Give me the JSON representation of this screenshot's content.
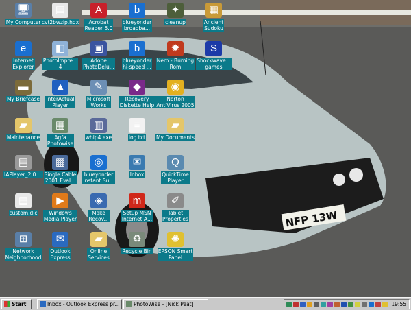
{
  "desktop": {
    "icons": [
      {
        "label": "My Computer",
        "icon": "my-computer-icon",
        "glyph": "🖥",
        "color": "#5a7fa8"
      },
      {
        "label": "cvt2bwzip.hqx",
        "icon": "file-icon",
        "glyph": "▤",
        "color": "#e8e8e8"
      },
      {
        "label": "Acrobat\nReader 5.0",
        "icon": "acrobat-icon",
        "glyph": "A",
        "color": "#c8202a"
      },
      {
        "label": "blueyonder\nbroadba...",
        "icon": "blueyonder-icon",
        "glyph": "b",
        "color": "#1a6fd0"
      },
      {
        "label": "cleanup",
        "icon": "cleanup-icon",
        "glyph": "✦",
        "color": "#4d5e3a"
      },
      {
        "label": "Ancient\nSudoku",
        "icon": "sudoku-icon",
        "glyph": "▦",
        "color": "#c99a38"
      },
      {
        "label": "Internet\nExplorer",
        "icon": "internet-explorer-icon",
        "glyph": "e",
        "color": "#1a6fd0"
      },
      {
        "label": "PhotoImpre...\n4",
        "icon": "photoimpression-icon",
        "glyph": "◧",
        "color": "#8fb2d8"
      },
      {
        "label": "Adobe\nPhotoDelu...",
        "icon": "photodeluxe-icon",
        "glyph": "▣",
        "color": "#3a54a0"
      },
      {
        "label": "blueyonder\nhi-speed ...",
        "icon": "blueyonder-icon",
        "glyph": "b",
        "color": "#1a6fd0"
      },
      {
        "label": "Nero - Burning\nRom",
        "icon": "nero-icon",
        "glyph": "✹",
        "color": "#c03a1e"
      },
      {
        "label": "Shockwave...\ngames",
        "icon": "shockwave-icon",
        "glyph": "S",
        "color": "#1c3aa8"
      },
      {
        "label": "My Briefcase",
        "icon": "briefcase-icon",
        "glyph": "▬",
        "color": "#7c6b3a"
      },
      {
        "label": "InterActual\nPlayer",
        "icon": "interactual-icon",
        "glyph": "▲",
        "color": "#2060c0"
      },
      {
        "label": "Microsoft\nWorks",
        "icon": "works-icon",
        "glyph": "✎",
        "color": "#6c8fb5"
      },
      {
        "label": "Recovery\nDiskette Help",
        "icon": "recovery-help-icon",
        "glyph": "◆",
        "color": "#7a2a8a"
      },
      {
        "label": "Norton\nAntiVirus 2005",
        "icon": "norton-icon",
        "glyph": "◉",
        "color": "#e3b020"
      },
      {
        "label": "Maintenance",
        "icon": "folder-icon",
        "glyph": "▰",
        "color": "#e4c66a"
      },
      {
        "label": "Agfa\nPhotowise",
        "icon": "agfa-icon",
        "glyph": "▦",
        "color": "#6a8a6a"
      },
      {
        "label": "whip4.exe",
        "icon": "exe-icon",
        "glyph": "▥",
        "color": "#5a6a9a"
      },
      {
        "label": "log.txt",
        "icon": "text-file-icon",
        "glyph": "≡",
        "color": "#f2f2f2"
      },
      {
        "label": "My Documents",
        "icon": "folder-icon",
        "glyph": "▰",
        "color": "#e4c66a"
      },
      {
        "label": "IAPlayer_2.0....",
        "icon": "installer-icon",
        "glyph": "▤",
        "color": "#9a9a9a"
      },
      {
        "label": "Single Cable\n2001 Eval...",
        "icon": "single-cable-icon",
        "glyph": "▩",
        "color": "#4a6a9a"
      },
      {
        "label": "blueyonder\nInstant Su...",
        "icon": "blueyonder-icon",
        "glyph": "◎",
        "color": "#1a6fd0"
      },
      {
        "label": "Inbox",
        "icon": "inbox-icon",
        "glyph": "✉",
        "color": "#3a7ab0"
      },
      {
        "label": "QuickTime\nPlayer",
        "icon": "quicktime-icon",
        "glyph": "Q",
        "color": "#5a8ab0"
      },
      {
        "label": "custom.dic",
        "icon": "dic-file-icon",
        "glyph": "▤",
        "color": "#e8e8e8"
      },
      {
        "label": "Windows\nMedia Player",
        "icon": "media-player-icon",
        "glyph": "▶",
        "color": "#e07a1a"
      },
      {
        "label": "Make\nRecov...",
        "icon": "make-recovery-icon",
        "glyph": "◈",
        "color": "#3a6ab0"
      },
      {
        "label": "Setup MSN\nInternet A...",
        "icon": "msn-icon",
        "glyph": "m",
        "color": "#d0281a"
      },
      {
        "label": "Tablet\nProperties",
        "icon": "tablet-icon",
        "glyph": "✐",
        "color": "#8a8a8a"
      },
      {
        "label": "Network\nNeighborhood",
        "icon": "network-icon",
        "glyph": "⊞",
        "color": "#5a7fa8"
      },
      {
        "label": "Outlook\nExpress",
        "icon": "outlook-express-icon",
        "glyph": "✉",
        "color": "#2a6ac0"
      },
      {
        "label": "Online\nServices",
        "icon": "folder-icon",
        "glyph": "▰",
        "color": "#e4c66a"
      },
      {
        "label": "Recycle Bin",
        "icon": "recycle-bin-icon",
        "glyph": "♻",
        "color": "#7a8a7a"
      },
      {
        "label": "EPSON Smart\nPanel",
        "icon": "epson-icon",
        "glyph": "✺",
        "color": "#e0c030"
      }
    ]
  },
  "wallpaper": {
    "plate": "NFP 13W",
    "sky_color": "#6e6e6a",
    "car_color": "#b8c4c4",
    "road_color": "#5a5a58"
  },
  "taskbar": {
    "start_label": "Start",
    "tasks": [
      {
        "label": "Inbox - Outlook Express pr...",
        "icon": "outlook-express-icon"
      },
      {
        "label": "PhotoWise - [Nick Peat]",
        "icon": "agfa-icon"
      }
    ],
    "tray_icons": [
      "#2e8b57",
      "#c03030",
      "#3060c0",
      "#e0a020",
      "#606060",
      "#30a0a0",
      "#a040a0",
      "#c06030",
      "#2050b0",
      "#409040",
      "#d0d040",
      "#707070",
      "#1a6fd0",
      "#c04040",
      "#e0c030"
    ],
    "clock": "19:55"
  }
}
